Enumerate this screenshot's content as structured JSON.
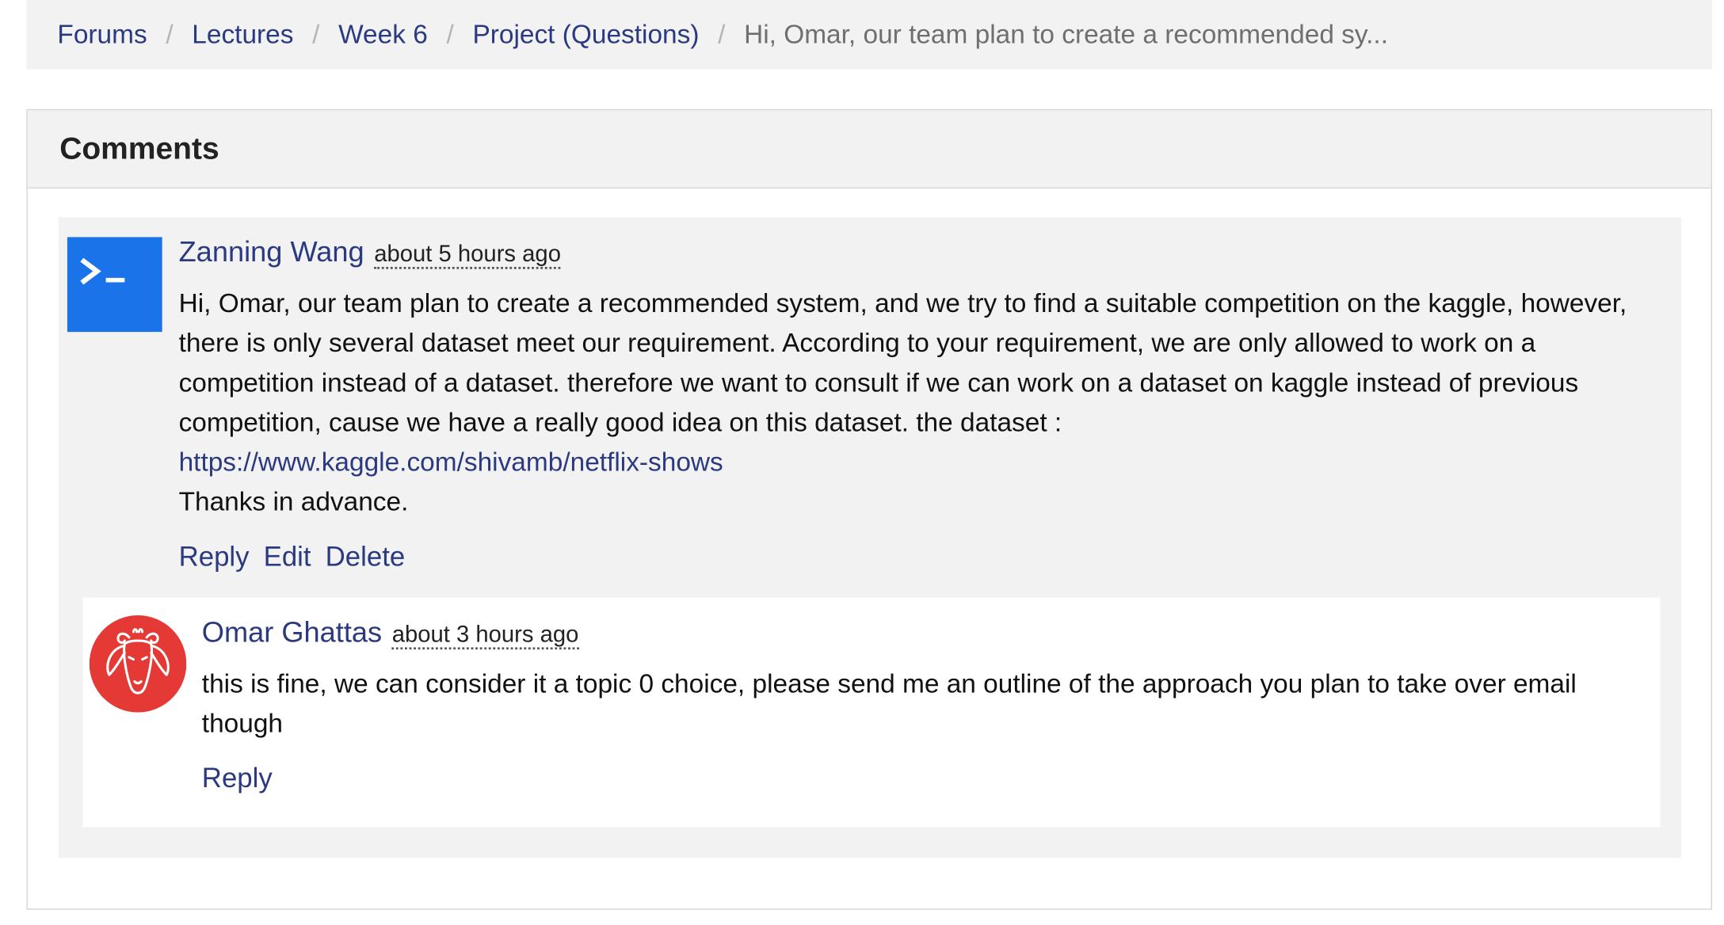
{
  "breadcrumb": {
    "items": [
      "Forums",
      "Lectures",
      "Week 6",
      "Project (Questions)"
    ],
    "current": "Hi, Omar, our team plan to create a recommended sy...",
    "separator": "/"
  },
  "panel": {
    "title": "Comments"
  },
  "comment": {
    "author": "Zanning Wang",
    "time": "about 5 hours ago",
    "text": "Hi, Omar, our team plan to create a recommended system, and we try to find a suitable competition on the kaggle, however, there is only several dataset meet our requirement. According to your requirement, we are only allowed to work on a competition instead of a dataset. therefore we want to consult if we can work on a dataset on kaggle instead of previous competition, cause we have a really good idea on this dataset. the dataset :",
    "link": "https://www.kaggle.com/shivamb/netflix-shows",
    "closing": "Thanks in advance.",
    "actions": {
      "reply": "Reply",
      "edit": "Edit",
      "delete": "Delete"
    },
    "avatar_icon": "terminal-icon"
  },
  "reply": {
    "author": "Omar Ghattas",
    "time": "about 3 hours ago",
    "text": "this is fine, we can consider it a topic 0 choice, please send me an outline of the approach you plan to take over email though",
    "actions": {
      "reply": "Reply"
    },
    "avatar_icon": "ram-icon"
  },
  "colors": {
    "link": "#2b3a80",
    "terminal_avatar": "#1a73e8",
    "ram_avatar": "#e53935",
    "panel_background": "#f2f2f2"
  }
}
